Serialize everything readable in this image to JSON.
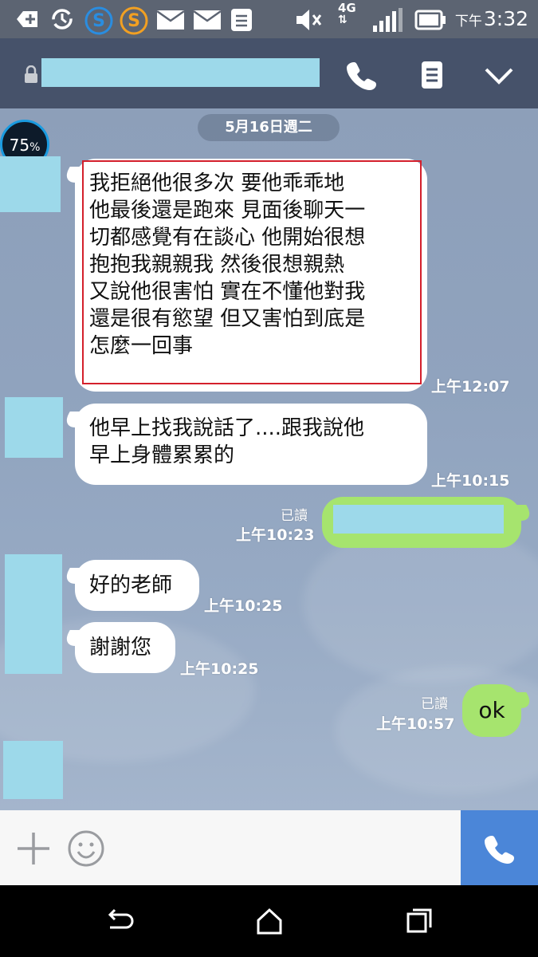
{
  "status_bar": {
    "network": "4G",
    "time_ampm": "下午",
    "time": "3:32",
    "icons": [
      "add-box-icon",
      "sync-icon",
      "s-app-blue-icon",
      "s-app-orange-icon",
      "mail-icon",
      "mail-icon",
      "note-icon",
      "mute-icon",
      "4g-icon",
      "signal-icon",
      "battery-icon"
    ]
  },
  "header": {
    "icons": [
      "lock-icon",
      "phone-icon",
      "menu-icon",
      "chevron-down-icon"
    ]
  },
  "chat": {
    "date": "5月16日週二",
    "battery_widget": {
      "value": "75",
      "unit": "%"
    },
    "messages": [
      {
        "side": "them",
        "lines": [
          "我拒絕他很多次 要他乖乖地",
          "他最後還是跑來 見面後聊天一",
          "切都感覺有在談心 他開始很想",
          "抱抱我親親我 然後很想親熱",
          "又說他很害怕 實在不懂他對我",
          "還是很有慾望 但又害怕到底是",
          "怎麼一回事"
        ],
        "time_ampm": "上午",
        "time": "12:07",
        "highlighted": true
      },
      {
        "side": "them",
        "lines": [
          "他早上找我說話了....跟我說他",
          "早上身體累累的"
        ],
        "time_ampm": "上午",
        "time": "10:15"
      },
      {
        "side": "me",
        "read": "已讀",
        "time_ampm": "上午",
        "time": "10:23",
        "redacted": true
      },
      {
        "side": "them",
        "text": "好的老師",
        "time_ampm": "上午",
        "time": "10:25"
      },
      {
        "side": "them",
        "text": "謝謝您",
        "time_ampm": "上午",
        "time": "10:25"
      },
      {
        "side": "me",
        "read": "已讀",
        "text": "ok",
        "time_ampm": "上午",
        "time": "10:57"
      }
    ]
  },
  "input_bar": {
    "icons": [
      "plus-icon",
      "emoji-icon",
      "phone-icon"
    ]
  },
  "nav_bar": {
    "icons": [
      "back-icon",
      "home-icon",
      "recents-icon"
    ]
  },
  "colors": {
    "header_bg": "#46526a",
    "my_bubble": "#a6e46e",
    "their_bubble": "#ffffff",
    "call_button": "#4b86d8",
    "highlight": "#d4202c",
    "redaction": "#9dd9ea"
  }
}
